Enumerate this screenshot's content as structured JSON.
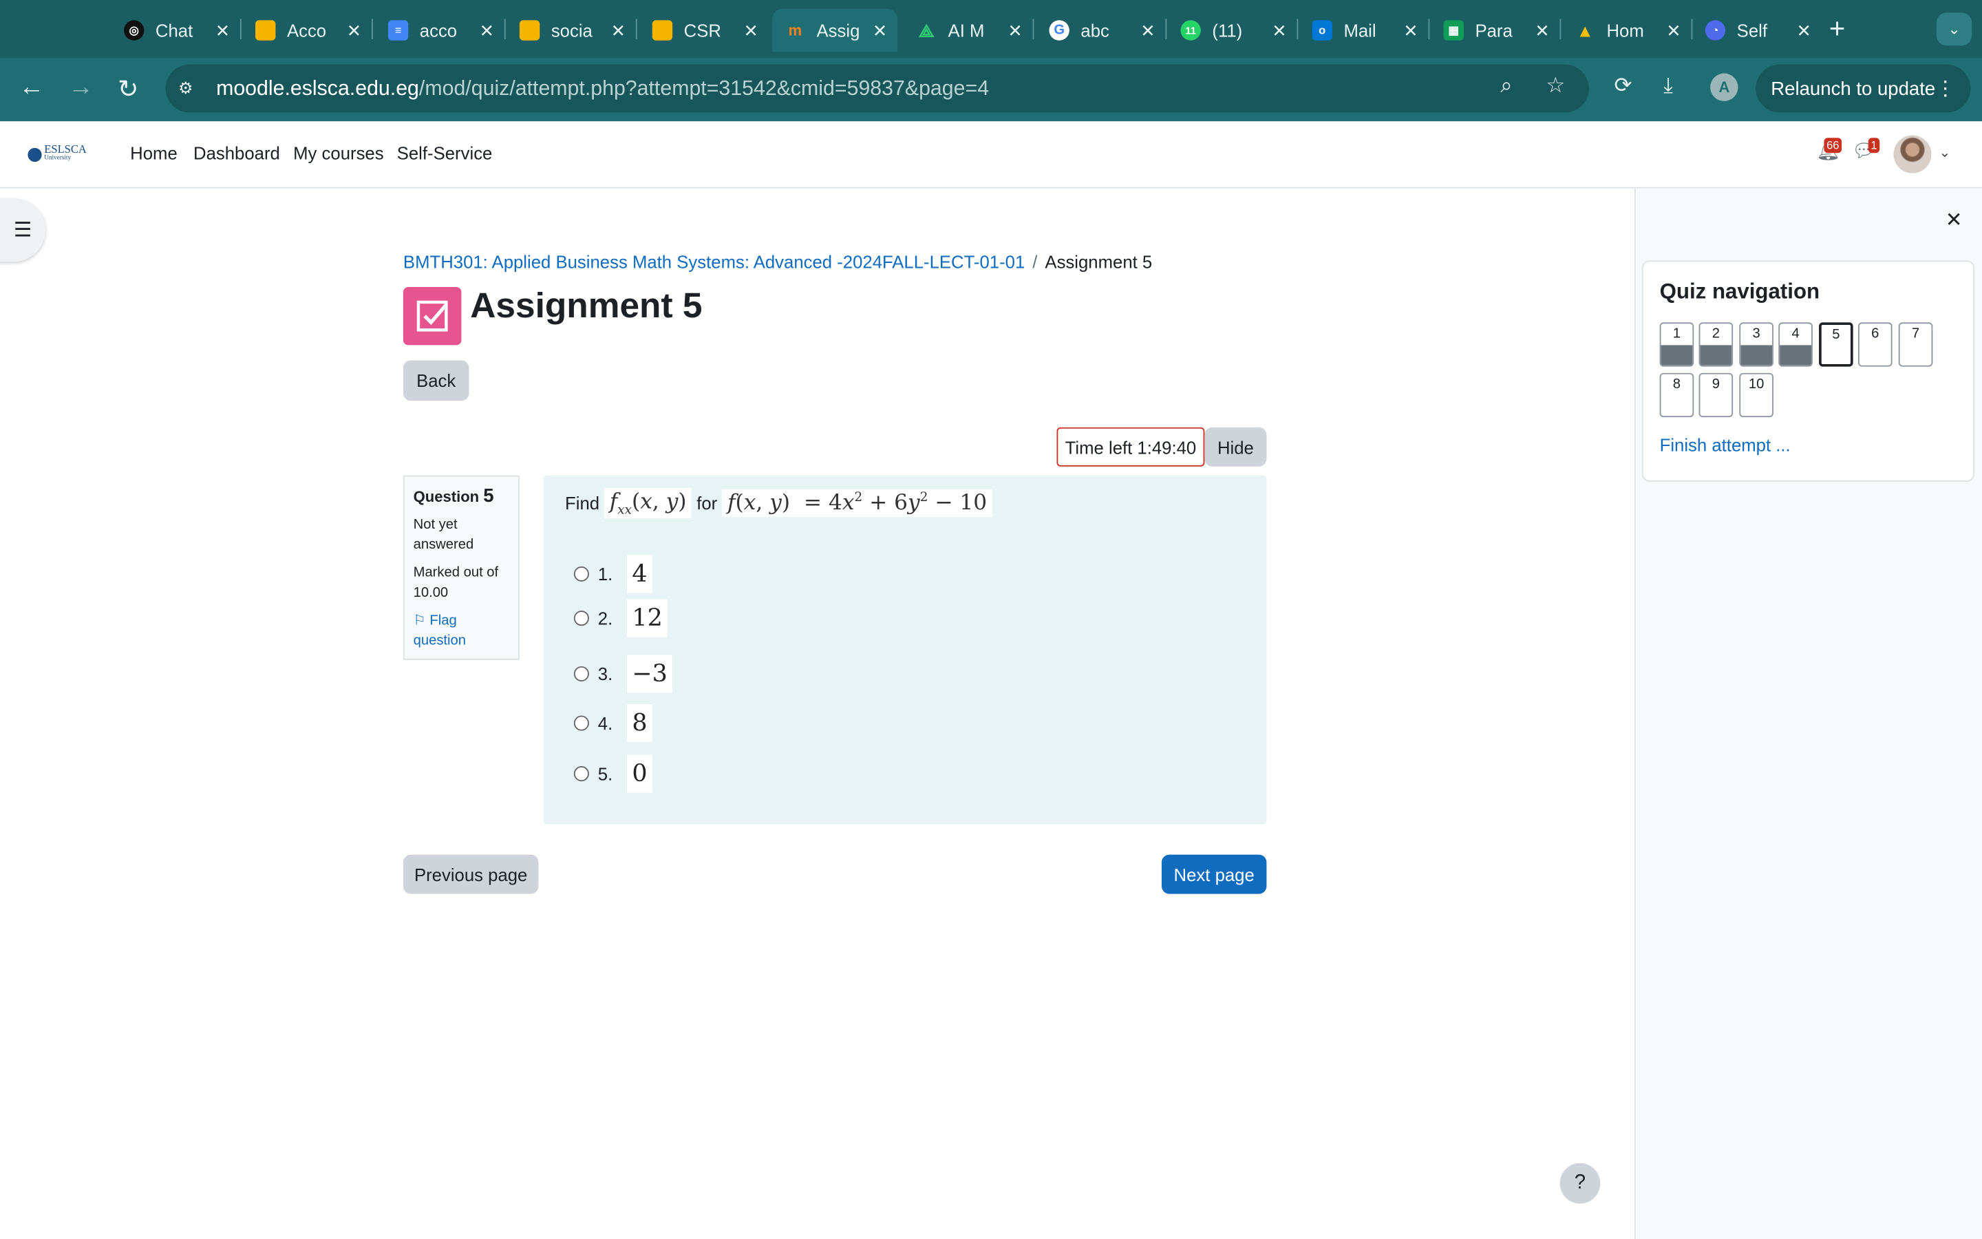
{
  "browser": {
    "tabs": [
      {
        "label": "Chat",
        "icon": "openai-icon",
        "color": "#111111"
      },
      {
        "label": "Acco",
        "icon": "slides-icon",
        "color": "#f4b400"
      },
      {
        "label": "acco",
        "icon": "docs-icon",
        "color": "#4285f4"
      },
      {
        "label": "socia",
        "icon": "slides-icon",
        "color": "#f4b400"
      },
      {
        "label": "CSR",
        "icon": "slides-icon",
        "color": "#f4b400"
      },
      {
        "label": "Assig",
        "icon": "moodle-icon",
        "color": "#f98012"
      },
      {
        "label": "AI M",
        "icon": "ai-icon",
        "color": "#0f9d58"
      },
      {
        "label": "abc",
        "icon": "google-icon",
        "color": "#ffffff"
      },
      {
        "label": "(11)",
        "icon": "whatsapp-icon",
        "color": "#25d366"
      },
      {
        "label": "Mail",
        "icon": "outlook-icon",
        "color": "#0078d4"
      },
      {
        "label": "Para",
        "icon": "sheets-icon",
        "color": "#0f9d58"
      },
      {
        "label": "Hom",
        "icon": "drive-icon",
        "color": "#fbbc04"
      },
      {
        "label": "Self",
        "icon": "self-service-icon",
        "color": "#4f6bed"
      }
    ],
    "active_tab_index": 5,
    "whatsapp_badge": "11",
    "url_host": "moodle.eslsca.edu.eg",
    "url_path": "/mod/quiz/attempt.php?attempt=31542&cmid=59837&page=4",
    "profile_initial": "A",
    "relaunch_label": "Relaunch to update"
  },
  "header": {
    "logo_text": "ESLSCA",
    "logo_sub": "University",
    "nav": [
      "Home",
      "Dashboard",
      "My courses",
      "Self-Service"
    ],
    "notifications_count": "66",
    "messages_count": "1"
  },
  "breadcrumb": {
    "course": "BMTH301: Applied Business Math Systems: Advanced -2024FALL-LECT-01-01",
    "separator": "/",
    "current": "Assignment 5"
  },
  "page_title": "Assignment 5",
  "back_label": "Back",
  "timer": {
    "label": "Time left 1:49:40",
    "hide_label": "Hide"
  },
  "question_info": {
    "question_label": "Question",
    "number": "5",
    "status": "Not yet answered",
    "marked": "Marked out of 10.00",
    "flag": "Flag question"
  },
  "question": {
    "find": "Find",
    "for": "for",
    "options": [
      {
        "label": "1.",
        "value": "4"
      },
      {
        "label": "2.",
        "value": "12"
      },
      {
        "label": "3.",
        "value": "−3"
      },
      {
        "label": "4.",
        "value": "8"
      },
      {
        "label": "5.",
        "value": "0"
      }
    ]
  },
  "buttons": {
    "previous": "Previous page",
    "next": "Next page"
  },
  "quiz_nav": {
    "title": "Quiz navigation",
    "items": [
      {
        "n": "1",
        "answered": true
      },
      {
        "n": "2",
        "answered": true
      },
      {
        "n": "3",
        "answered": true
      },
      {
        "n": "4",
        "answered": true
      },
      {
        "n": "5",
        "answered": false,
        "current": true
      },
      {
        "n": "6",
        "answered": false
      },
      {
        "n": "7",
        "answered": false
      },
      {
        "n": "8",
        "answered": false
      },
      {
        "n": "9",
        "answered": false
      },
      {
        "n": "10",
        "answered": false
      }
    ],
    "finish_label": "Finish attempt ..."
  },
  "help_label": "?",
  "colors": {
    "accent": "#0f6cbf",
    "browser": "#1f6e74",
    "assignment_icon": "#e6558f",
    "timer_border": "#ca3120"
  }
}
